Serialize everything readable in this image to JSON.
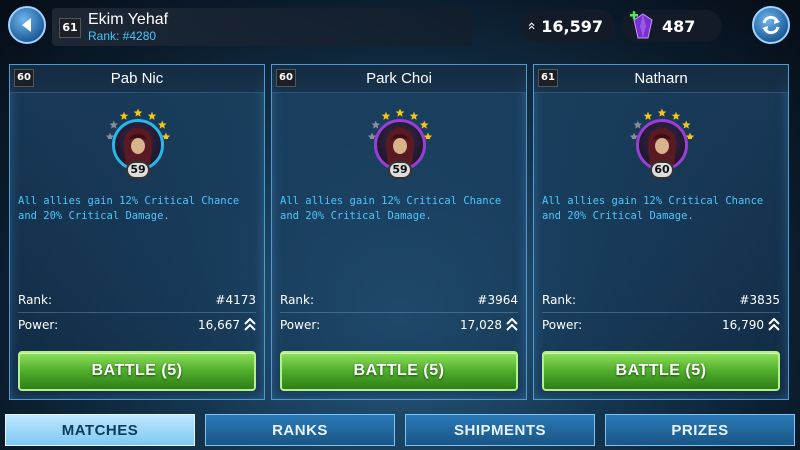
{
  "player": {
    "level": "61",
    "name": "Ekim Yehaf",
    "rank": "Rank: #4280"
  },
  "currency": {
    "power_value": "16,597",
    "crystals_value": "487"
  },
  "opponents": [
    {
      "level": "60",
      "name": "Pab Nic",
      "portrait_level": "59",
      "stars": 5,
      "frame_color": "#29b6e8",
      "ability": "All allies gain 12% Critical Chance and 20% Critical Damage.",
      "rank_label": "Rank:",
      "rank_value": "#4173",
      "power_label": "Power:",
      "power_value": "16,667",
      "battle_label": "BATTLE (5)"
    },
    {
      "level": "60",
      "name": "Park Choi",
      "portrait_level": "59",
      "stars": 5,
      "frame_color": "#9a3ed8",
      "ability": "All allies gain 12% Critical Chance and 20% Critical Damage.",
      "rank_label": "Rank:",
      "rank_value": "#3964",
      "power_label": "Power:",
      "power_value": "17,028",
      "battle_label": "BATTLE (5)"
    },
    {
      "level": "61",
      "name": "Natharn",
      "portrait_level": "60",
      "stars": 5,
      "frame_color": "#9a3ed8",
      "ability": "All allies gain 12% Critical Chance and 20% Critical Damage.",
      "rank_label": "Rank:",
      "rank_value": "#3835",
      "power_label": "Power:",
      "power_value": "16,790",
      "battle_label": "BATTLE (5)"
    }
  ],
  "tabs": [
    {
      "label": "MATCHES",
      "active": true
    },
    {
      "label": "RANKS",
      "active": false
    },
    {
      "label": "SHIPMENTS",
      "active": false
    },
    {
      "label": "PRIZES",
      "active": false
    }
  ],
  "colors": {
    "accent_blue": "#44c8ff",
    "battle_green": "#4fae2c",
    "star_gold": "#f5c518"
  },
  "icons": {
    "back": "back-arrow-icon",
    "power": "chevron-up-double-icon",
    "crystal": "crystal-icon",
    "refresh": "refresh-icon"
  }
}
